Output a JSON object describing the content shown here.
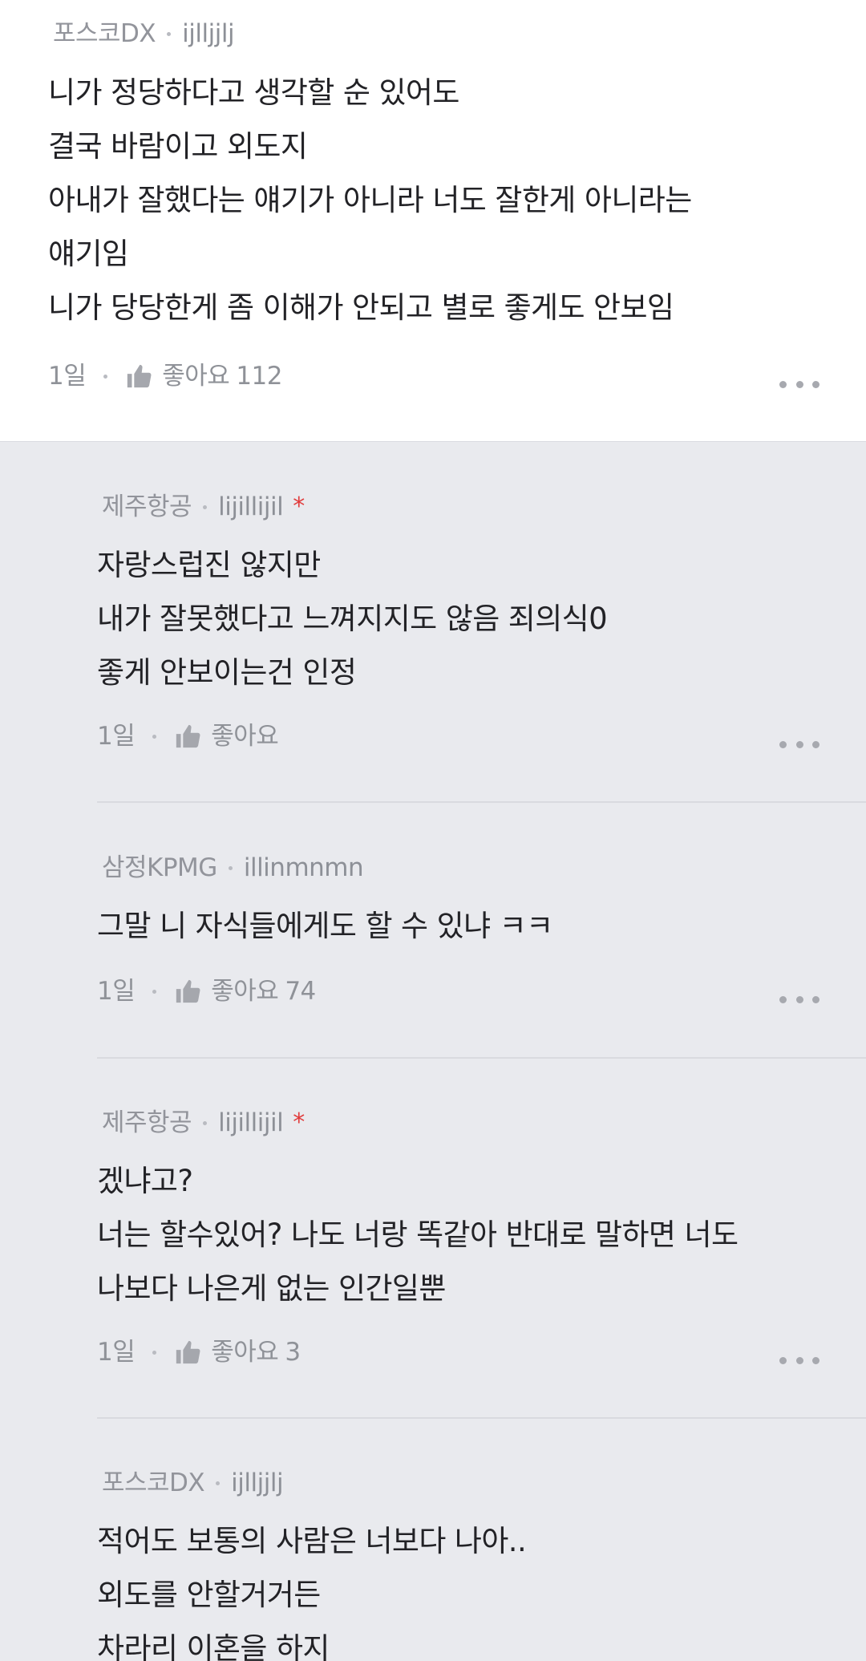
{
  "comments": [
    {
      "company": "포스코DX",
      "username": "ijlljjlj",
      "star": "",
      "lines": [
        "니가 정당하다고 생각할 순 있어도",
        "결국 바람이고 외도지",
        "아내가 잘했다는 얘기가 아니라 너도 잘한게 아니라는",
        "얘기임",
        "니가 당당한게 좀 이해가 안되고 별로 좋게도 안보임"
      ],
      "time": "1일",
      "like_label": "좋아요",
      "like_count": "112"
    },
    {
      "company": "제주항공",
      "username": "lijillijil",
      "star": "*",
      "lines": [
        "자랑스럽진 않지만",
        "내가 잘못했다고 느껴지지도 않음 죄의식0",
        "좋게 안보이는건 인정"
      ],
      "time": "1일",
      "like_label": "좋아요",
      "like_count": ""
    },
    {
      "company": "삼정KPMG",
      "username": "illinmnmn",
      "star": "",
      "lines": [
        "그말 니 자식들에게도 할 수 있냐 ㅋㅋ"
      ],
      "time": "1일",
      "like_label": "좋아요",
      "like_count": "74"
    },
    {
      "company": "제주항공",
      "username": "lijillijil",
      "star": "*",
      "lines": [
        "겠냐고?",
        "너는 할수있어? 나도 너랑 똑같아 반대로 말하면 너도",
        "나보다 나은게 없는 인간일뿐"
      ],
      "time": "1일",
      "like_label": "좋아요",
      "like_count": "3"
    },
    {
      "company": "포스코DX",
      "username": "ijlljjlj",
      "star": "",
      "lines": [
        "적어도 보통의 사람은 너보다 나아..",
        "외도를 안할거거든",
        "차라리 이혼을 하지"
      ]
    }
  ],
  "icons": {
    "like": "thumbs-up-icon",
    "more": "more-options-icon"
  },
  "colors": {
    "top_background": "#ffffff",
    "reply_background": "#e9eaee",
    "star": "#e13b3b"
  }
}
